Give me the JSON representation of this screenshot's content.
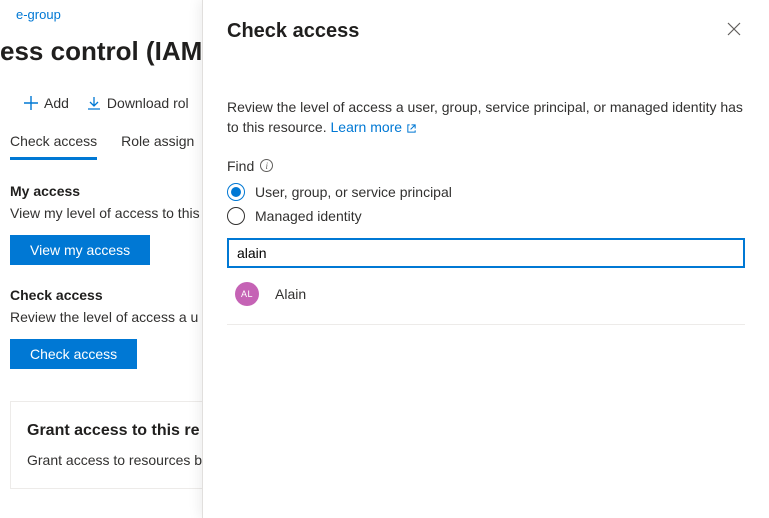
{
  "breadcrumb": {
    "current": "e-group"
  },
  "page": {
    "title": "ess control (IAM)"
  },
  "toolbar": {
    "add_label": "Add",
    "download_label": "Download rol"
  },
  "tabs": {
    "check_access": "Check access",
    "role_assign": "Role assign"
  },
  "my_access": {
    "heading": "My access",
    "desc": "View my level of access to this",
    "button": "View my access"
  },
  "check_access": {
    "heading": "Check access",
    "desc": "Review the level of access a u",
    "button": "Check access"
  },
  "grant": {
    "heading": "Grant access to this re",
    "desc": "Grant access to resources b"
  },
  "panel": {
    "title": "Check access",
    "description_prefix": "Review the level of access a user, group, service principal, or managed identity has to this resource. ",
    "learn_more": "Learn more",
    "find_label": "Find",
    "options": {
      "user": "User, group, or service principal",
      "managed": "Managed identity"
    },
    "search_value": "alain",
    "results": [
      {
        "initials": "AL",
        "name": "Alain"
      }
    ]
  }
}
